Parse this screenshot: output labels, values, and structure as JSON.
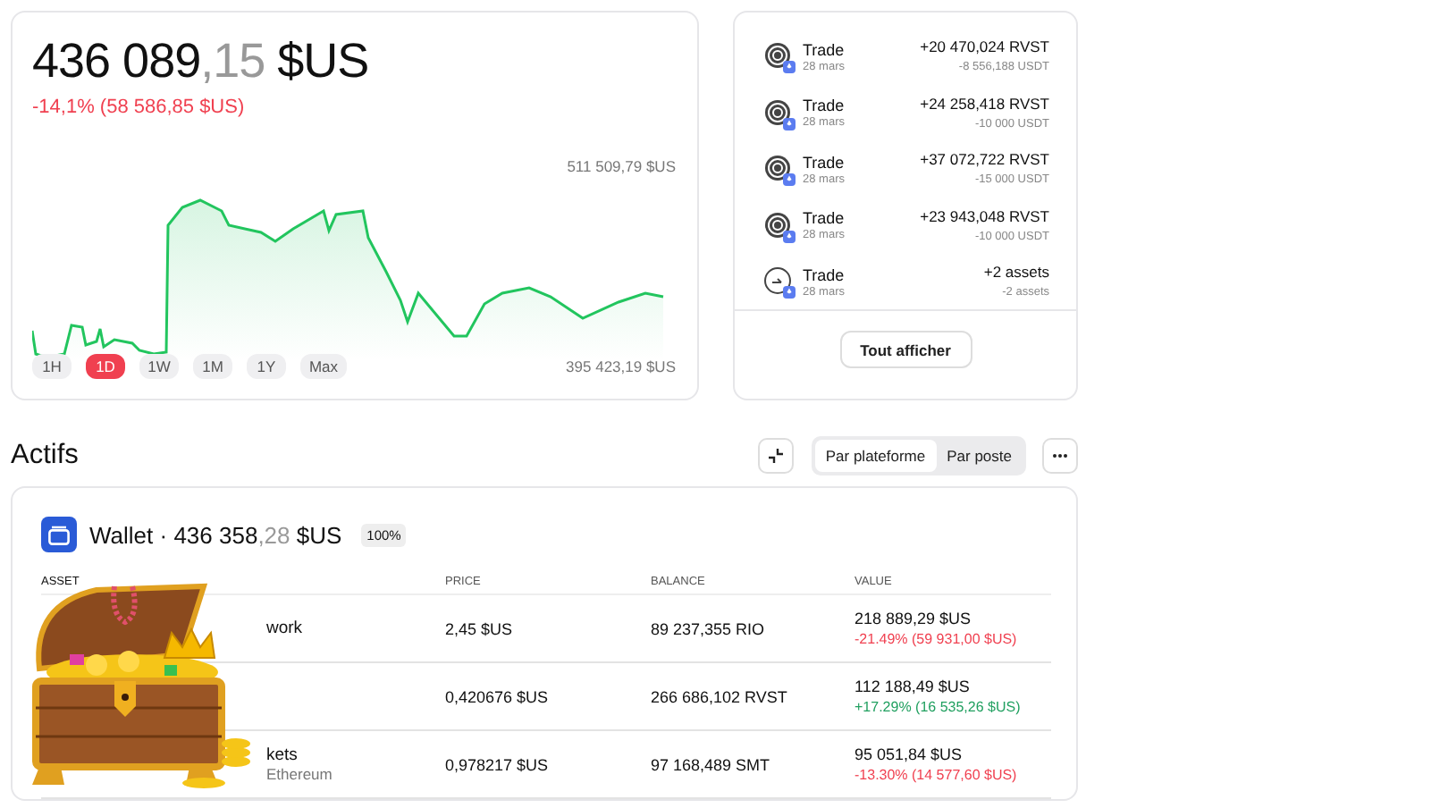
{
  "portfolio": {
    "balance_main": "436 089",
    "balance_decimals": ",15",
    "currency": "$US",
    "change": "-14,1% (58 586,85 $US)",
    "color": "#f04050",
    "chart_max": "511 509,79 $US",
    "chart_min": "395 423,19 $US",
    "ranges": [
      {
        "label": "1H",
        "selected": false
      },
      {
        "label": "1D",
        "selected": true
      },
      {
        "label": "1W",
        "selected": false
      },
      {
        "label": "1M",
        "selected": false
      },
      {
        "label": "1Y",
        "selected": false
      },
      {
        "label": "Max",
        "selected": false
      }
    ]
  },
  "transactions": {
    "items": [
      {
        "kind": "token",
        "title": "Trade",
        "date": "28 mars",
        "received": "+20 470,024 RVST",
        "sent": "-8 556,188 USDT"
      },
      {
        "kind": "token",
        "title": "Trade",
        "date": "28 mars",
        "received": "+24 258,418 RVST",
        "sent": "-10 000 USDT"
      },
      {
        "kind": "token",
        "title": "Trade",
        "date": "28 mars",
        "received": "+37 072,722 RVST",
        "sent": "-15 000 USDT"
      },
      {
        "kind": "token",
        "title": "Trade",
        "date": "28 mars",
        "received": "+23 943,048 RVST",
        "sent": "-10 000 USDT"
      },
      {
        "kind": "multi",
        "title": "Trade",
        "date": "28 mars",
        "received": "+2 assets",
        "sent": "-2 assets"
      }
    ],
    "show_all": "Tout afficher"
  },
  "assets": {
    "title": "Actifs",
    "views": [
      {
        "label": "Par plateforme",
        "selected": true
      },
      {
        "label": "Par poste",
        "selected": false
      }
    ],
    "wallet": {
      "name": "Wallet · 436 358",
      "decimals": ",28",
      "currency": " $US",
      "share": "100%"
    },
    "columns": [
      "ASSET",
      "PRICE",
      "BALANCE",
      "VALUE"
    ],
    "rows": [
      {
        "name": "work",
        "price": "2,45 $US",
        "balance": "89 237,355 RIO",
        "value": "218 889,29 $US",
        "change": "-21.49% (59 931,00 $US)",
        "color": "#f04050"
      },
      {
        "price": "0,420676 $US",
        "balance": "266 686,102 RVST",
        "value": "112 188,49 $US",
        "change": "+17.29% (16 535,26 $US)",
        "color": "#21a060"
      },
      {
        "name": "kets",
        "network": "Ethereum",
        "price": "0,978217 $US",
        "balance": "97 168,489 SMT",
        "value": "95 051,84 $US",
        "change": "-13.30% (14 577,60 $US)",
        "color": "#f04050"
      }
    ]
  }
}
